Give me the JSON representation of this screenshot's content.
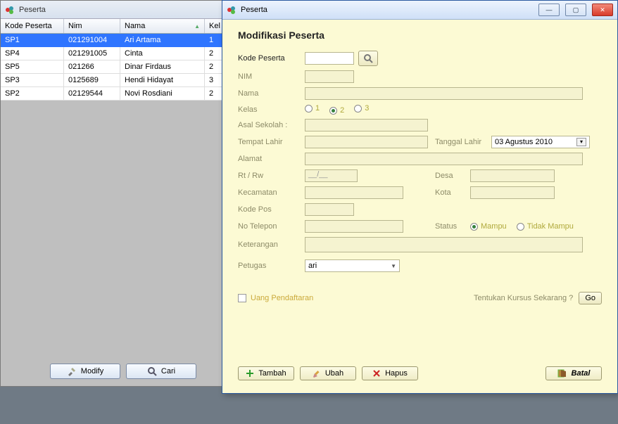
{
  "back_window": {
    "title": "Peserta",
    "columns": [
      "Kode Peserta",
      "Nim",
      "Nama",
      "Kel"
    ],
    "sort_col_index": 2,
    "rows": [
      {
        "kode": "SP1",
        "nim": "021291004",
        "nama": "Ari Artama",
        "kelas": "1",
        "selected": true
      },
      {
        "kode": "SP4",
        "nim": "021291005",
        "nama": "Cinta",
        "kelas": "2",
        "selected": false
      },
      {
        "kode": "SP5",
        "nim": "021266",
        "nama": "Dinar Firdaus",
        "kelas": "2",
        "selected": false
      },
      {
        "kode": "SP3",
        "nim": "0125689",
        "nama": "Hendi Hidayat",
        "kelas": "3",
        "selected": false
      },
      {
        "kode": "SP2",
        "nim": "02129544",
        "nama": "Novi Rosdiani",
        "kelas": "2",
        "selected": false
      }
    ],
    "buttons": {
      "modify": "Modify",
      "cari": "Cari"
    }
  },
  "front_window": {
    "title": "Peserta",
    "heading": "Modifikasi Peserta",
    "labels": {
      "kode": "Kode Peserta",
      "nim": "NIM",
      "nama": "Nama",
      "kelas": "Kelas",
      "asal": "Asal Sekolah :",
      "tmplahir": "Tempat Lahir",
      "tgllahir": "Tanggal Lahir",
      "alamat": "Alamat",
      "rtrw": "Rt / Rw",
      "desa": "Desa",
      "kecamatan": "Kecamatan",
      "kota": "Kota",
      "kodepos": "Kode Pos",
      "notelp": "No Telepon",
      "status": "Status",
      "keterangan": "Keterangan",
      "petugas": "Petugas"
    },
    "kelas_options": [
      "1",
      "2",
      "3"
    ],
    "kelas_selected": "2",
    "date_value": "03  Agustus   2010",
    "rtrw_value": "__/__",
    "status_options": {
      "mampu": "Mampu",
      "tidak": "Tidak Mampu"
    },
    "status_selected": "mampu",
    "petugas_value": "ari",
    "checkbox_label": "Uang Pendaftaran",
    "kursus_prompt": "Tentukan Kursus Sekarang  ?",
    "go_label": "Go",
    "buttons": {
      "tambah": "Tambah",
      "ubah": "Ubah",
      "hapus": "Hapus",
      "batal": "Batal"
    }
  }
}
